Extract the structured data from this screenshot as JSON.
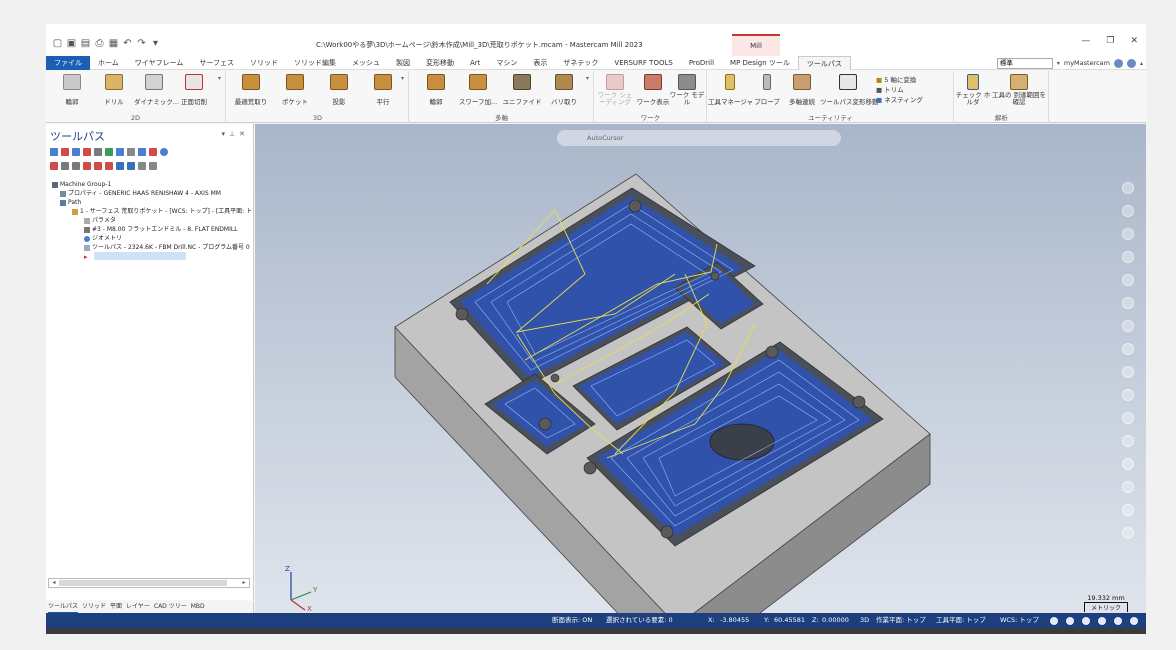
{
  "title": "C:\\Work00やる夢\\3D\\ホームページ\\鈴木作成\\Mill_3D\\荒取りポケット.mcam - Mastercam Mill 2023",
  "context_tab": "Mill",
  "menu_tabs": [
    "ファイル",
    "ホーム",
    "ワイヤフレーム",
    "サーフェス",
    "ソリッド",
    "ソリッド編集",
    "メッシュ",
    "製図",
    "変形移動",
    "Art",
    "マシン",
    "表示",
    "ザネテック",
    "VERSURF TOOLS",
    "ProDrill",
    "MP Design ツール",
    "ツールパス"
  ],
  "search_select": "標準",
  "my_mastercam": "myMastercam",
  "ribbon": {
    "g2d_label": "2D",
    "g2d": [
      "輪郭",
      "ドリル",
      "ダイナミック...",
      "正面切削"
    ],
    "g3d_label": "3D",
    "g3d": [
      "最適荒取り",
      "ポケット",
      "投影",
      "平行"
    ],
    "multi_label": "多軸",
    "multi": [
      "輪郭",
      "スワーフ加...",
      "ユニファイド",
      "バリ取り"
    ],
    "work_label": "ワーク",
    "work": [
      "ワーク シェーディング",
      "ワーク表示",
      "ワーク モデル"
    ],
    "util_label": "ユーティリティ",
    "util": [
      "工具マネージャ",
      "プローブ",
      "多軸連続",
      "ツールパス変形移動"
    ],
    "util_small": [
      "5 軸に変換",
      "トリム",
      "ネスティング"
    ],
    "analysis_label": "解析",
    "analysis": [
      "チェック ホルダ",
      "工具の 到達範囲を確認"
    ]
  },
  "panel": {
    "title": "ツールパス",
    "tree": [
      "Machine Group-1",
      "プロパティ - GENERIC HAAS RENISHAW 4 - AXIS MM",
      "Path",
      "1 - サーフェス 荒取りポケット - [WCS: トップ] - [工具平面: トップ]",
      "パラメタ",
      "#3 - M8.00 フラットエンドミル - 8. FLAT ENDMILL",
      "ジオメトリ",
      "ツールパス - 2324.6K - FBM Drill.NC - プログラム番号 0"
    ]
  },
  "bottom_tabs": [
    "ツールパス",
    "ソリッド",
    "平面",
    "レイヤー",
    "CAD ツリー",
    "MBD"
  ],
  "viewport": {
    "autocursor": "AutoCursor",
    "scale_value": "19.332 mm",
    "scale_unit": "メトリック",
    "axis_x": "X",
    "axis_y": "Y",
    "axis_z": "Z"
  },
  "status": {
    "section": "断面表示: ON",
    "selected": "選択されている要素: 0",
    "x_label": "X:",
    "x_value": "-3.80455",
    "y_label": "Y:",
    "y_value": "60.45581",
    "z_label": "Z:",
    "z_value": "0.00000",
    "mode": "3D",
    "cplane": "作業平面: トップ",
    "tplane": "工具平面: トップ",
    "wcs": "WCS: トップ"
  },
  "colors": {
    "accent": "#1a5fb4",
    "status_bar": "#1d3f7e",
    "toolpath": "#1f5bd6",
    "rapid": "#e6e14a"
  }
}
